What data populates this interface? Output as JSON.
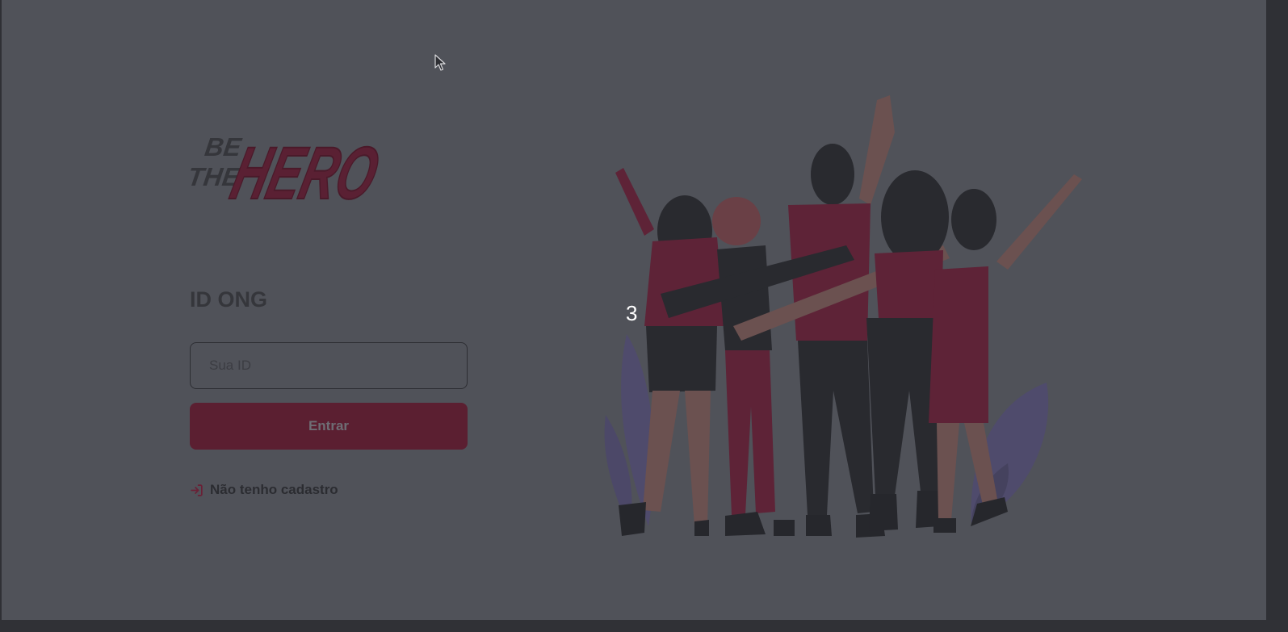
{
  "brand": {
    "logo_line1": "BE",
    "logo_line2": "THE",
    "logo_word": "HERO"
  },
  "login": {
    "title": "ID ONG",
    "id_placeholder": "Sua ID",
    "submit_label": "Entrar",
    "register_label": "Não tenho cadastro"
  },
  "overlay": {
    "counter": "3"
  },
  "icons": {
    "register": "log-in-icon",
    "cursor": "mouse-pointer-icon"
  },
  "colors": {
    "background": "#505259",
    "accent": "#5b1f31",
    "text_dark": "#35363b"
  }
}
